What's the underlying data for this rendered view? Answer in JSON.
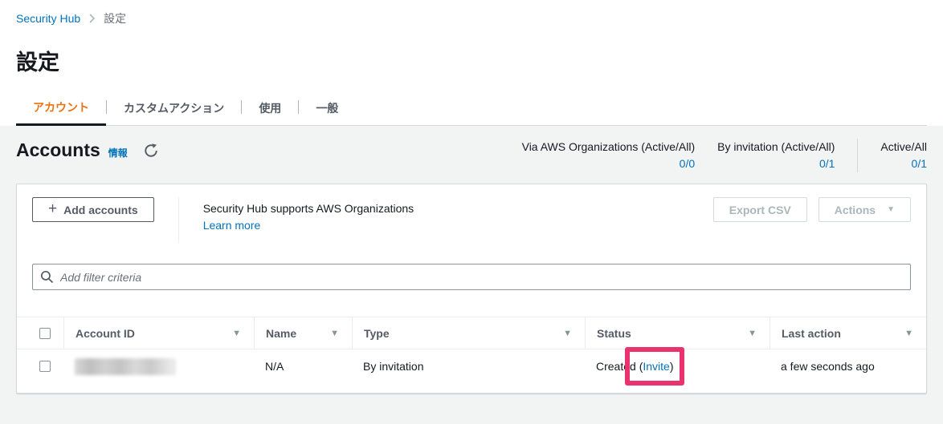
{
  "breadcrumb": {
    "root": "Security Hub",
    "current": "設定"
  },
  "page": {
    "title": "設定"
  },
  "tabs": [
    {
      "label": "アカウント",
      "active": true
    },
    {
      "label": "カスタムアクション",
      "active": false
    },
    {
      "label": "使用",
      "active": false
    },
    {
      "label": "一般",
      "active": false
    }
  ],
  "accounts_header": {
    "title": "Accounts",
    "info_label": "情報",
    "stats": [
      {
        "label": "Via AWS Organizations (Active/All)",
        "value": "0/0"
      },
      {
        "label": "By invitation (Active/All)",
        "value": "0/1"
      },
      {
        "label": "Active/All",
        "value": "0/1"
      }
    ]
  },
  "toolbar": {
    "add_accounts_label": "Add accounts",
    "support_text": "Security Hub supports AWS Organizations",
    "learn_more_label": "Learn more",
    "export_csv_label": "Export CSV",
    "actions_label": "Actions"
  },
  "filter": {
    "placeholder": "Add filter criteria"
  },
  "table": {
    "columns": [
      {
        "label": "Account ID"
      },
      {
        "label": "Name"
      },
      {
        "label": "Type"
      },
      {
        "label": "Status"
      },
      {
        "label": "Last action"
      }
    ],
    "rows": [
      {
        "account_id_redacted": true,
        "name": "N/A",
        "type": "By invitation",
        "status_prefix": "Created (",
        "status_link": "Invite",
        "status_suffix": ")",
        "last_action": "a few seconds ago"
      }
    ]
  },
  "annotation": {
    "highlight_color": "#ea336e"
  },
  "colors": {
    "link_blue": "#0073bb",
    "active_tab_orange": "#ec7211",
    "text_dark": "#16191f",
    "text_secondary": "#545b64",
    "disabled": "#aab7b8",
    "page_bg": "#f2f3f3"
  },
  "glyphs": {
    "plus": "+",
    "caret_down": "▼",
    "sort_down": "▼"
  }
}
